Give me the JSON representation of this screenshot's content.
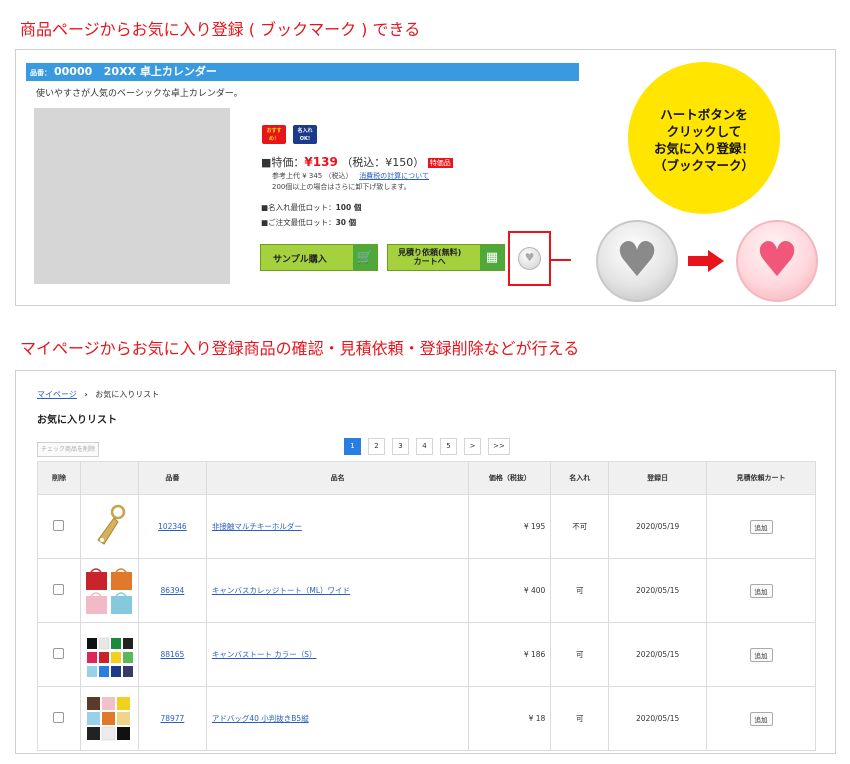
{
  "headings": {
    "h1": "商品ページからお気に入り登録 ( ブックマーク ) できる",
    "h2": "マイページからお気に入り登録商品の確認・見積依頼・登録削除などが行える"
  },
  "product": {
    "code_label": "品番：",
    "code": "00000",
    "name": "20XX 卓上カレンダー",
    "subtitle": "使いやすさが人気のベーシックな卓上カレンダー。",
    "badge_recommend": "おすすめ！",
    "badge_name": "名入れOK!",
    "price_prefix": "■特価：",
    "price": "¥139",
    "tax_incl": "（税込：¥150）",
    "tag": "特価品",
    "ref_text": "参考上代 ¥ 345 （税込）",
    "ref_link": "消費税の計算について",
    "discount_note": "200個以上の場合はさらに卸下げ致します。",
    "lot_name_label": "■名入れ最低ロット：",
    "lot_name_value": "100 個",
    "lot_order_label": "■ご注文最低ロット：",
    "lot_order_value": "30 個",
    "btn_sample": "サンプル購入",
    "btn_quote_line1": "見積り依頼(無料)",
    "btn_quote_line2": "カートへ"
  },
  "callout": {
    "line1": "ハートボタンを",
    "line2": "クリックして",
    "line3": "お気に入り登録！",
    "line4": "（ブックマーク）"
  },
  "icons": {
    "small_heart": "heart-icon",
    "gray_heart": "heart-icon",
    "pink_heart": "heart-icon",
    "cart": "cart-icon",
    "calculator": "calculator-icon",
    "arrow": "arrow-right-icon"
  },
  "colors": {
    "accent_red": "#e8141b",
    "title_blue": "#3a9ae0",
    "button_green": "#a5d13f",
    "callout_yellow": "#ffe500",
    "link_blue": "#2a5fbd",
    "pager_active": "#2a7de1"
  },
  "favorites": {
    "breadcrumb_home": "マイページ",
    "breadcrumb_sep": "›",
    "breadcrumb_current": "お気に入りリスト",
    "title": "お気に入りリスト",
    "delete_checked": "チェック商品を削除",
    "pages": [
      "1",
      "2",
      "3",
      "4",
      "5",
      ">",
      ">>"
    ],
    "active_page": "1",
    "columns": [
      "削除",
      "",
      "品番",
      "品名",
      "価格（税抜）",
      "名入れ",
      "登録日",
      "見積依頼カート"
    ],
    "rows": [
      {
        "code": "102346",
        "name": "非接触マルチキーホルダー",
        "price": "¥ 195",
        "naire": "不可",
        "date": "2020/05/19",
        "add": "追加",
        "thumb": "keyholder"
      },
      {
        "code": "86394",
        "name": "キャンバスカレッジトート（ML）ワイド",
        "price": "¥ 400",
        "naire": "可",
        "date": "2020/05/15",
        "add": "追加",
        "thumb": "tote4"
      },
      {
        "code": "88165",
        "name": "キャンバストート カラー（S）",
        "price": "¥ 186",
        "naire": "可",
        "date": "2020/05/15",
        "add": "追加",
        "thumb": "tote12"
      },
      {
        "code": "78977",
        "name": "アドバッグ40 小判抜きB5縦",
        "price": "¥ 18",
        "naire": "可",
        "date": "2020/05/15",
        "add": "追加",
        "thumb": "bag9"
      }
    ]
  }
}
